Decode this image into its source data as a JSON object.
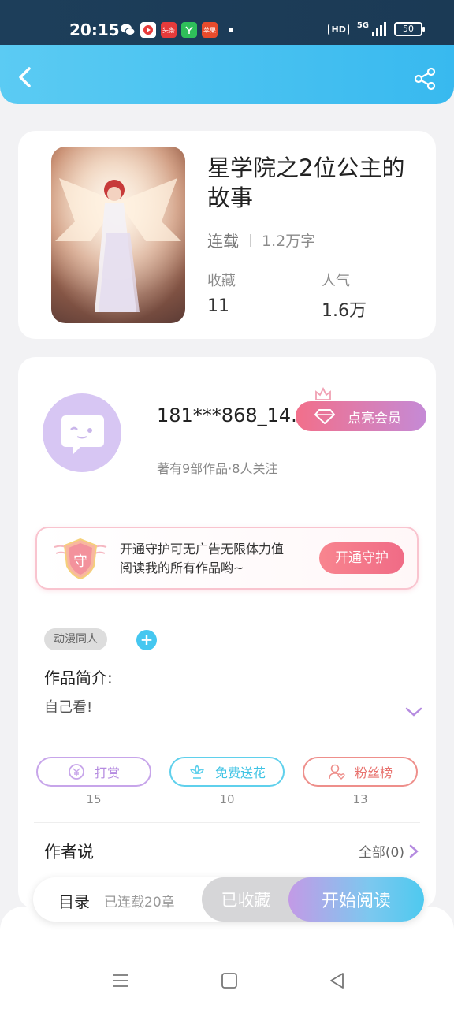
{
  "status_bar": {
    "time": "20:15",
    "network": "5G",
    "hd": "HD",
    "battery": "50",
    "app_icons": [
      "wechat-icon",
      "video-icon",
      "toutiao-icon",
      "green-app-icon",
      "red-app-icon"
    ],
    "app_icon_labels": [
      "",
      "",
      "头条",
      "",
      "苹果"
    ]
  },
  "header": {
    "back_icon": "chevron-left-icon",
    "share_icon": "share-icon"
  },
  "book": {
    "title": "星学院之2位公主的故事",
    "status": "连载",
    "word_count": "1.2万字",
    "favorites_label": "收藏",
    "favorites_value": "11",
    "popularity_label": "人气",
    "popularity_value": "1.6万"
  },
  "author": {
    "name": "181***868_14...",
    "sub": "著有9部作品·8人关注",
    "vip_label": "点亮会员"
  },
  "guard": {
    "text_line1": "开通守护可无广告无限体力值",
    "text_line2": "阅读我的所有作品哟~",
    "button": "开通守护",
    "shield_char": "守"
  },
  "tags": {
    "items": [
      "动漫同人"
    ],
    "add": "+"
  },
  "intro": {
    "label": "作品简介:",
    "text": "自己看!"
  },
  "actions": [
    {
      "label": "打赏",
      "count": "15",
      "color": "#b58be0"
    },
    {
      "label": "免费送花",
      "count": "10",
      "color": "#3ec3e4"
    },
    {
      "label": "粉丝榜",
      "count": "13",
      "color": "#e8726e"
    }
  ],
  "author_says": {
    "title": "作者说",
    "all_label": "全部(0)"
  },
  "bottom": {
    "toc_label": "目录",
    "toc_sub": "已连载20章",
    "collected": "已收藏",
    "read": "开始阅读"
  },
  "nav": [
    "menu-icon",
    "home-icon",
    "back-icon"
  ]
}
